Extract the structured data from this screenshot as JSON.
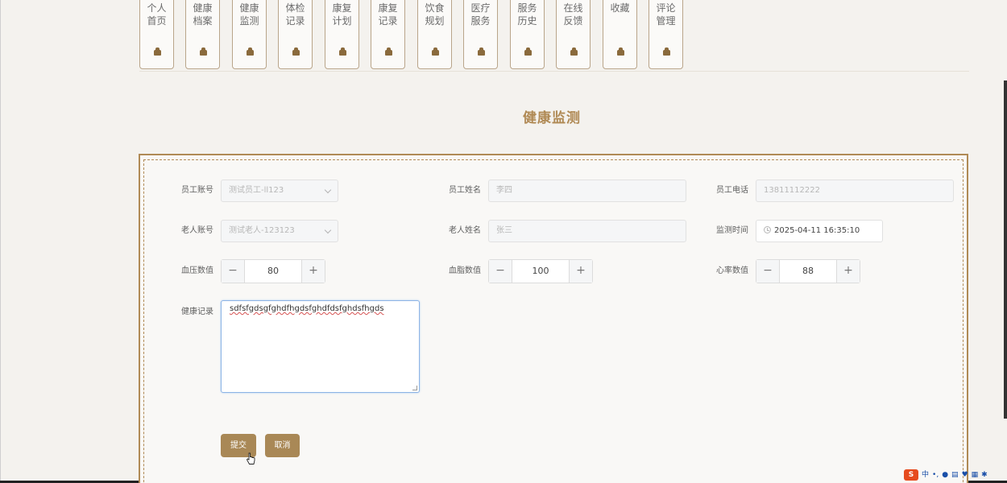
{
  "nav": {
    "tabs": [
      {
        "label": "个人首页",
        "icon": "home-icon"
      },
      {
        "label": "健康档案",
        "icon": "home-icon"
      },
      {
        "label": "健康监测",
        "icon": "home-icon"
      },
      {
        "label": "体检记录",
        "icon": "home-icon"
      },
      {
        "label": "康复计划",
        "icon": "home-icon"
      },
      {
        "label": "康复记录",
        "icon": "home-icon"
      },
      {
        "label": "饮食规划",
        "icon": "home-icon"
      },
      {
        "label": "医疗服务",
        "icon": "home-icon"
      },
      {
        "label": "服务历史",
        "icon": "home-icon"
      },
      {
        "label": "在线反馈",
        "icon": "home-icon"
      },
      {
        "label": "收藏",
        "icon": "home-icon"
      },
      {
        "label": "评论管理",
        "icon": "home-icon"
      }
    ]
  },
  "page": {
    "title": "健康监测"
  },
  "form": {
    "staff_account": {
      "label": "员工账号",
      "value": "测试员工-ll123"
    },
    "staff_name": {
      "label": "员工姓名",
      "value": "李四"
    },
    "staff_phone": {
      "label": "员工电话",
      "value": "13811112222"
    },
    "elder_account": {
      "label": "老人账号",
      "value": "测试老人-123123"
    },
    "elder_name": {
      "label": "老人姓名",
      "value": "张三"
    },
    "monitor_time": {
      "label": "监测时间",
      "value": "2025-04-11 16:35:10"
    },
    "blood_pressure": {
      "label": "血压数值",
      "value": "80"
    },
    "blood_lipid": {
      "label": "血脂数值",
      "value": "100"
    },
    "heart_rate": {
      "label": "心率数值",
      "value": "88"
    },
    "health_record": {
      "label": "健康记录",
      "value": "sdfsfgdsgfghdfhgdsfghdfdsfghdsfhgds"
    },
    "stepper_minus": "−",
    "stepper_plus": "+"
  },
  "actions": {
    "submit": "提交",
    "cancel": "取消"
  },
  "tray": {
    "ime_logo": "S",
    "ime_mode": "中",
    "punct": "•,"
  },
  "colors": {
    "accent": "#a98856",
    "title": "#b08a55",
    "border": "#b08a55"
  }
}
